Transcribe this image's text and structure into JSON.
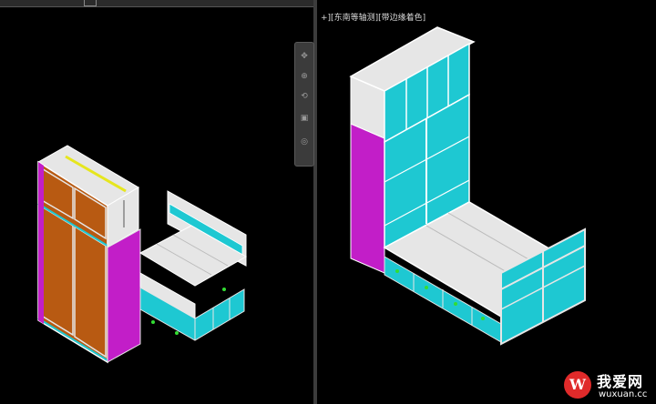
{
  "viewport_right": {
    "label": "+][东南等轴测][带边缘着色]"
  },
  "nav_bar": {
    "icons": [
      "pan-icon",
      "zoom-icon",
      "orbit-icon",
      "showmotion-icon",
      "steering-wheel-icon"
    ]
  },
  "watermark": {
    "logo_letter": "W",
    "brand_cn": "我爱网",
    "url": "wuxuan.cc"
  },
  "colors": {
    "background": "#000000",
    "magenta_side": "#c21ec8",
    "orange_door": "#b85a12",
    "cyan_door": "#1ec8d2",
    "panel_white": "#e6e6e6",
    "yellow_edge": "#e6e61e",
    "green_marker": "#33dd33"
  }
}
